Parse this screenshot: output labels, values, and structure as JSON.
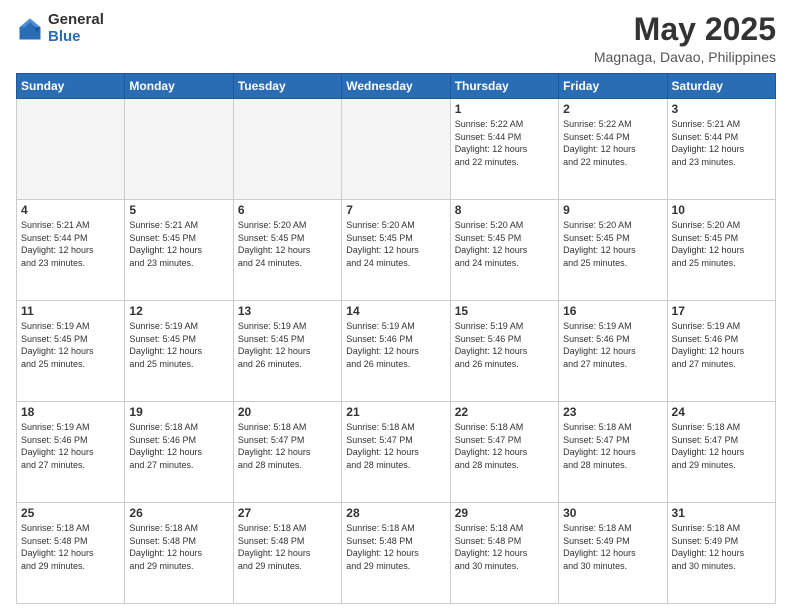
{
  "logo": {
    "general": "General",
    "blue": "Blue"
  },
  "title": "May 2025",
  "subtitle": "Magnaga, Davao, Philippines",
  "days_header": [
    "Sunday",
    "Monday",
    "Tuesday",
    "Wednesday",
    "Thursday",
    "Friday",
    "Saturday"
  ],
  "weeks": [
    [
      {
        "day": "",
        "info": "",
        "empty": true
      },
      {
        "day": "",
        "info": "",
        "empty": true
      },
      {
        "day": "",
        "info": "",
        "empty": true
      },
      {
        "day": "",
        "info": "",
        "empty": true
      },
      {
        "day": "1",
        "info": "Sunrise: 5:22 AM\nSunset: 5:44 PM\nDaylight: 12 hours\nand 22 minutes."
      },
      {
        "day": "2",
        "info": "Sunrise: 5:22 AM\nSunset: 5:44 PM\nDaylight: 12 hours\nand 22 minutes."
      },
      {
        "day": "3",
        "info": "Sunrise: 5:21 AM\nSunset: 5:44 PM\nDaylight: 12 hours\nand 23 minutes."
      }
    ],
    [
      {
        "day": "4",
        "info": "Sunrise: 5:21 AM\nSunset: 5:44 PM\nDaylight: 12 hours\nand 23 minutes."
      },
      {
        "day": "5",
        "info": "Sunrise: 5:21 AM\nSunset: 5:45 PM\nDaylight: 12 hours\nand 23 minutes."
      },
      {
        "day": "6",
        "info": "Sunrise: 5:20 AM\nSunset: 5:45 PM\nDaylight: 12 hours\nand 24 minutes."
      },
      {
        "day": "7",
        "info": "Sunrise: 5:20 AM\nSunset: 5:45 PM\nDaylight: 12 hours\nand 24 minutes."
      },
      {
        "day": "8",
        "info": "Sunrise: 5:20 AM\nSunset: 5:45 PM\nDaylight: 12 hours\nand 24 minutes."
      },
      {
        "day": "9",
        "info": "Sunrise: 5:20 AM\nSunset: 5:45 PM\nDaylight: 12 hours\nand 25 minutes."
      },
      {
        "day": "10",
        "info": "Sunrise: 5:20 AM\nSunset: 5:45 PM\nDaylight: 12 hours\nand 25 minutes."
      }
    ],
    [
      {
        "day": "11",
        "info": "Sunrise: 5:19 AM\nSunset: 5:45 PM\nDaylight: 12 hours\nand 25 minutes."
      },
      {
        "day": "12",
        "info": "Sunrise: 5:19 AM\nSunset: 5:45 PM\nDaylight: 12 hours\nand 25 minutes."
      },
      {
        "day": "13",
        "info": "Sunrise: 5:19 AM\nSunset: 5:45 PM\nDaylight: 12 hours\nand 26 minutes."
      },
      {
        "day": "14",
        "info": "Sunrise: 5:19 AM\nSunset: 5:46 PM\nDaylight: 12 hours\nand 26 minutes."
      },
      {
        "day": "15",
        "info": "Sunrise: 5:19 AM\nSunset: 5:46 PM\nDaylight: 12 hours\nand 26 minutes."
      },
      {
        "day": "16",
        "info": "Sunrise: 5:19 AM\nSunset: 5:46 PM\nDaylight: 12 hours\nand 27 minutes."
      },
      {
        "day": "17",
        "info": "Sunrise: 5:19 AM\nSunset: 5:46 PM\nDaylight: 12 hours\nand 27 minutes."
      }
    ],
    [
      {
        "day": "18",
        "info": "Sunrise: 5:19 AM\nSunset: 5:46 PM\nDaylight: 12 hours\nand 27 minutes."
      },
      {
        "day": "19",
        "info": "Sunrise: 5:18 AM\nSunset: 5:46 PM\nDaylight: 12 hours\nand 27 minutes."
      },
      {
        "day": "20",
        "info": "Sunrise: 5:18 AM\nSunset: 5:47 PM\nDaylight: 12 hours\nand 28 minutes."
      },
      {
        "day": "21",
        "info": "Sunrise: 5:18 AM\nSunset: 5:47 PM\nDaylight: 12 hours\nand 28 minutes."
      },
      {
        "day": "22",
        "info": "Sunrise: 5:18 AM\nSunset: 5:47 PM\nDaylight: 12 hours\nand 28 minutes."
      },
      {
        "day": "23",
        "info": "Sunrise: 5:18 AM\nSunset: 5:47 PM\nDaylight: 12 hours\nand 28 minutes."
      },
      {
        "day": "24",
        "info": "Sunrise: 5:18 AM\nSunset: 5:47 PM\nDaylight: 12 hours\nand 29 minutes."
      }
    ],
    [
      {
        "day": "25",
        "info": "Sunrise: 5:18 AM\nSunset: 5:48 PM\nDaylight: 12 hours\nand 29 minutes."
      },
      {
        "day": "26",
        "info": "Sunrise: 5:18 AM\nSunset: 5:48 PM\nDaylight: 12 hours\nand 29 minutes."
      },
      {
        "day": "27",
        "info": "Sunrise: 5:18 AM\nSunset: 5:48 PM\nDaylight: 12 hours\nand 29 minutes."
      },
      {
        "day": "28",
        "info": "Sunrise: 5:18 AM\nSunset: 5:48 PM\nDaylight: 12 hours\nand 29 minutes."
      },
      {
        "day": "29",
        "info": "Sunrise: 5:18 AM\nSunset: 5:48 PM\nDaylight: 12 hours\nand 30 minutes."
      },
      {
        "day": "30",
        "info": "Sunrise: 5:18 AM\nSunset: 5:49 PM\nDaylight: 12 hours\nand 30 minutes."
      },
      {
        "day": "31",
        "info": "Sunrise: 5:18 AM\nSunset: 5:49 PM\nDaylight: 12 hours\nand 30 minutes."
      }
    ]
  ]
}
